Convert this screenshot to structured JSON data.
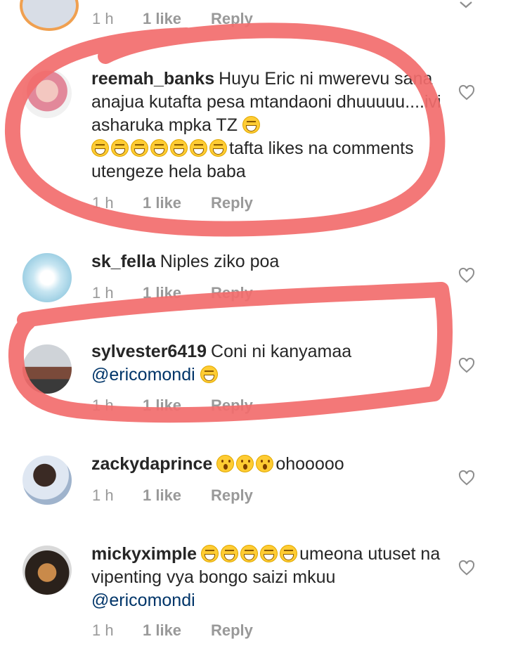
{
  "comments": [
    {
      "username": "",
      "time": "1 h",
      "likes": "1 like",
      "reply": "Reply"
    },
    {
      "username": "reemah_banks",
      "text_1": "Huyu Eric ni mwerevu sana anajua kutafta pesa mtandaoni dhuuuuu....ivi asharuka mpka TZ ",
      "text_2": "tafta likes na comments utengeze hela baba",
      "time": "1 h",
      "likes": "1 like",
      "reply": "Reply"
    },
    {
      "username": "sk_fella",
      "text_1": "Niples ziko poa",
      "time": "1 h",
      "likes": "1 like",
      "reply": "Reply"
    },
    {
      "username": "sylvester6419",
      "text_1": "Coni ni kanyamaa",
      "mention": "@ericomondi",
      "time": "1 h",
      "likes": "1 like",
      "reply": "Reply"
    },
    {
      "username": "zackydaprince",
      "text_1": "ohooooo",
      "time": "1 h",
      "likes": "1 like",
      "reply": "Reply"
    },
    {
      "username": "mickyximple",
      "text_1": "umeona utuset na vipenting vya bongo saizi mkuu",
      "mention": "@ericomondi",
      "time": "1 h",
      "likes": "1 like",
      "reply": "Reply"
    }
  ],
  "icons": {
    "heart": "heart-outline-icon",
    "chevron": "chevron-down-icon",
    "laugh_emoji": "grinning-squinting-face-emoji",
    "wow_emoji": "face-with-open-mouth-emoji"
  },
  "colors": {
    "highlight": "#f26d6d",
    "meta_text": "#999999",
    "mention": "#003569"
  }
}
